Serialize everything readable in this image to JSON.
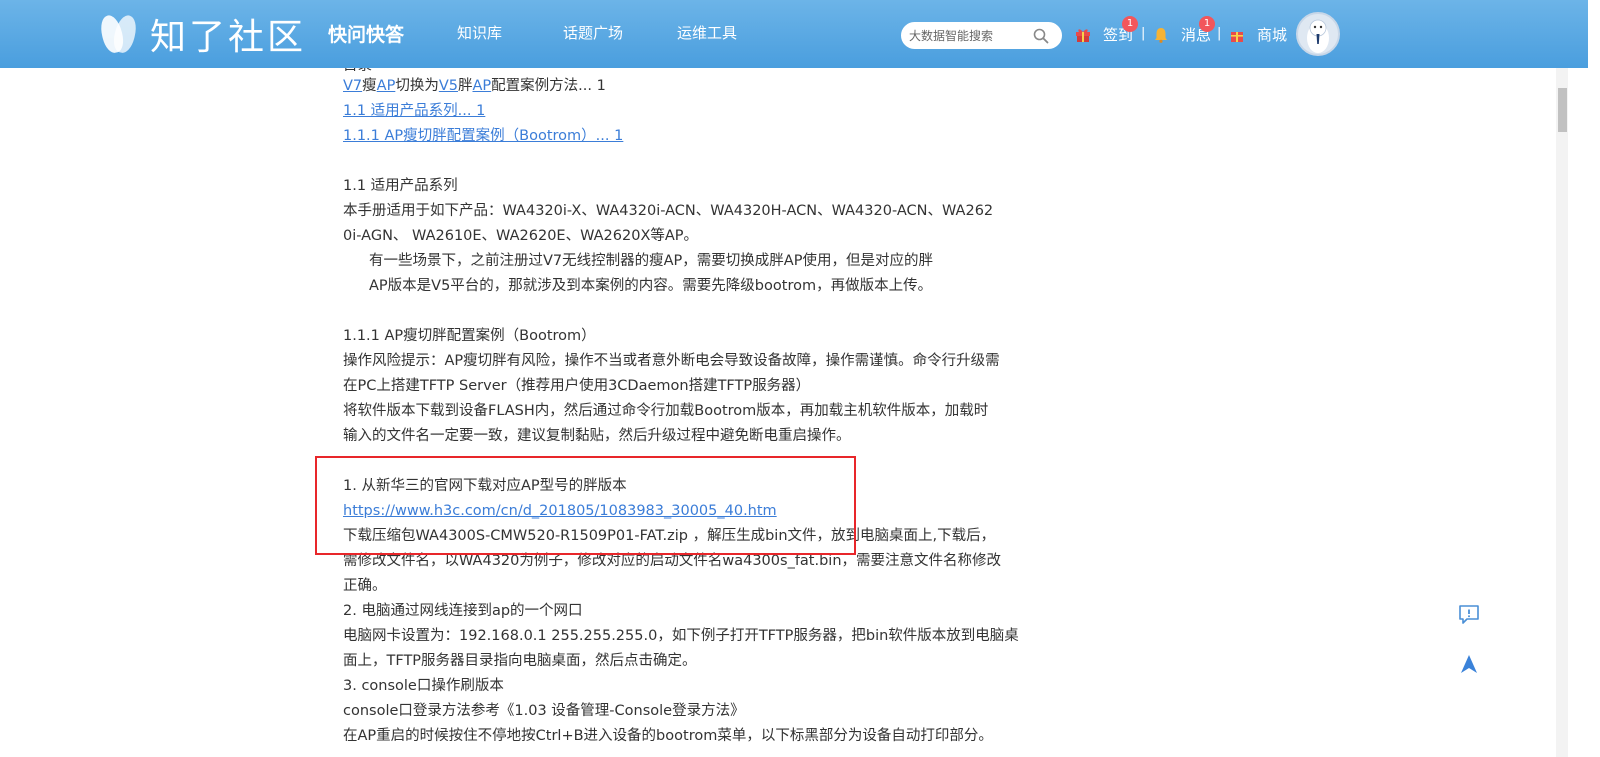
{
  "header": {
    "logo_text": "知了社区",
    "nav": [
      {
        "label": "快问快答",
        "key": "qa"
      },
      {
        "label": "知识库",
        "key": "kb"
      },
      {
        "label": "话题广场",
        "key": "topics"
      },
      {
        "label": "运维工具",
        "key": "tools"
      }
    ],
    "search_placeholder": "大数据智能搜索",
    "signin_label": "签到",
    "signin_badge": "1",
    "messages_label": "消息",
    "messages_badge": "1",
    "shop_label": "商城",
    "separator": "|"
  },
  "article": {
    "partial_top": "目录",
    "toc": [
      {
        "parts": [
          "V7",
          "瘦",
          "AP",
          "切换为",
          "V5",
          "胖",
          "AP",
          "配置案例方法... 1"
        ]
      },
      {
        "text": "1.1 适用产品系列... 1"
      },
      {
        "text": "1.1.1 AP瘦切胖配置案例（Bootrom）... 1"
      }
    ],
    "sec_1_1_title": "1.1  适用产品系列",
    "sec_1_1_body_1": "本手册适用于如下产品：WA4320i-X、WA4320i-ACN、WA4320H-ACN、WA4320-ACN、WA262",
    "sec_1_1_body_2": "0i-AGN、 WA2610E、WA2620E、WA2620X等AP。",
    "sec_1_1_body_3": "有一些场景下，之前注册过V7无线控制器的瘦AP，需要切换成胖AP使用，但是对应的胖",
    "sec_1_1_body_4": "AP版本是V5平台的，那就涉及到本案例的内容。需要先降级bootrom，再做版本上传。",
    "sec_1_1_1_title": "1.1.1  AP瘦切胖配置案例（Bootrom）",
    "risk_1": "操作风险提示：AP瘦切胖有风险，操作不当或者意外断电会导致设备故障，操作需谨慎。命令行升级需",
    "risk_2": "在PC上搭建TFTP Server（推荐用户使用3CDaemon搭建TFTP服务器）",
    "risk_3": "将软件版本下载到设备FLASH内，然后通过命令行加载Bootrom版本，再加载主机软件版本，加载时",
    "risk_4": "输入的文件名一定要一致，建议复制黏贴，然后升级过程中避免断电重启操作。",
    "step1_title": "1. 从新华三的官网下载对应AP型号的胖版本",
    "step1_link": "https://www.h3c.com/cn/d_201805/1083983_30005_40.htm",
    "step1_body_1": "下载压缩包WA4300S-CMW520-R1509P01-FAT.zip ，解压生成bin文件，放到电脑桌面上,下载后，",
    "step1_body_2": "需修改文件名，以WA4320为例子，修改对应的启动文件名wa4300s_fat.bin，需要注意文件名称修改",
    "step1_body_3": "正确。",
    "step2_title": "2. 电脑通过网线连接到ap的一个网口",
    "step2_body_1": "电脑网卡设置为：192.168.0.1 255.255.255.0，如下例子打开TFTP服务器，把bin软件版本放到电脑桌",
    "step2_body_2": "面上，TFTP服务器目录指向电脑桌面，然后点击确定。",
    "step3_title": "3. console口操作刷版本",
    "step3_body_1": "console口登录方法参考《1.03 设备管理-Console登录方法》",
    "step3_body_2": "在AP重启的时候按住不停地按Ctrl+B进入设备的bootrom菜单，以下标黑部分为设备自动打印部分。"
  },
  "colors": {
    "header_bg": "#55a5e2",
    "link": "#3b7dd8",
    "highlight_border": "#e8262a",
    "badge": "#f2565b"
  }
}
